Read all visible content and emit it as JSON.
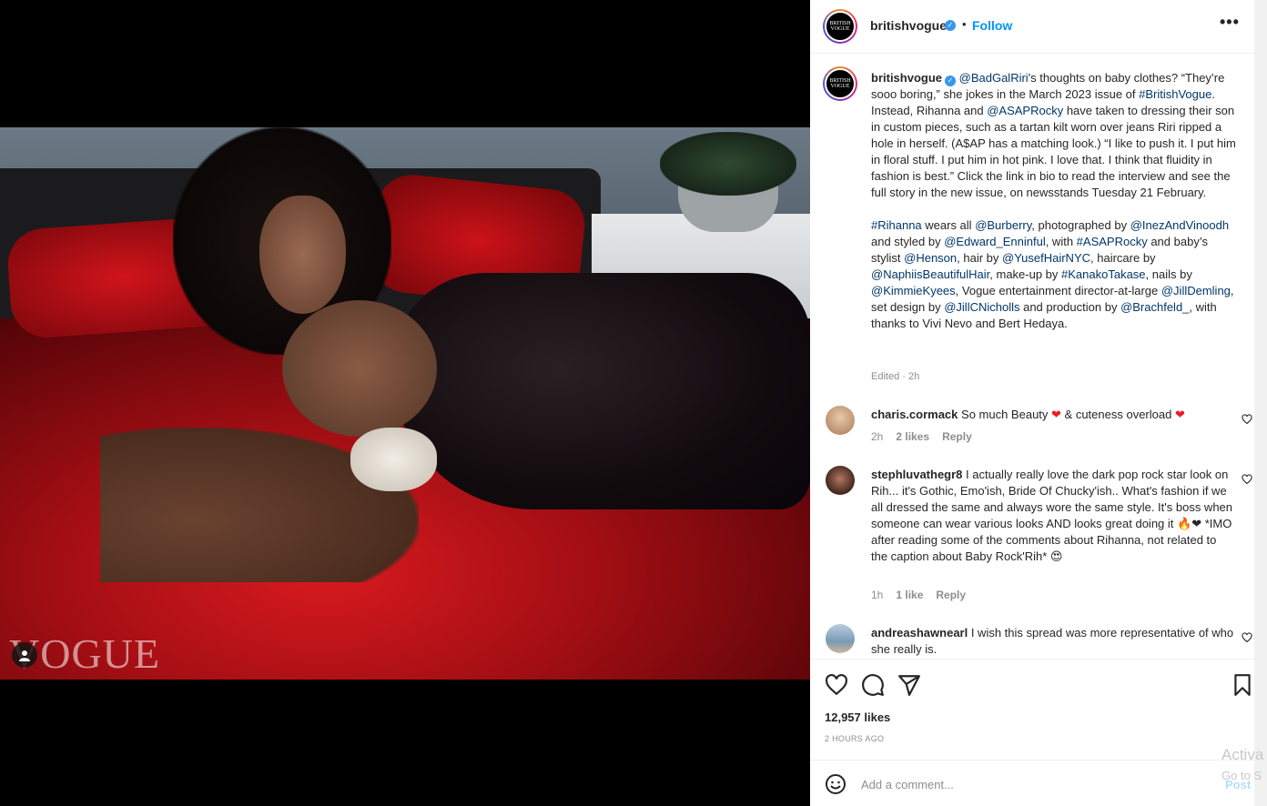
{
  "post": {
    "account": "britishvogue",
    "avatar_text": "BRITISH VOGUE",
    "follow_label": "Follow",
    "more_label": "•••",
    "watermark": "VOGUE"
  },
  "caption": {
    "username": "britishvogue",
    "parts": [
      {
        "t": "@BadGalRiri",
        "link": true
      },
      {
        "t": "'s thoughts on baby clothes? “They’re sooo boring,” she jokes in the March 2023 issue of ",
        "link": false
      },
      {
        "t": "#BritishVogue",
        "link": true
      },
      {
        "t": ". Instead, Rihanna and ",
        "link": false
      },
      {
        "t": "@ASAPRocky",
        "link": true
      },
      {
        "t": " have taken to dressing their son in custom pieces, such as a tartan kilt worn over jeans Riri ripped a hole in herself. (A$AP has a matching look.) “I like to push it. I put him in floral stuff. I put him in hot pink. I love that. I think that fluidity in fashion is best.” Click the link in bio to read the interview and see the full story in the new issue, on newsstands Tuesday 21 February.",
        "link": false
      }
    ],
    "credits": [
      {
        "t": "#Rihanna",
        "link": true
      },
      {
        "t": " wears all ",
        "link": false
      },
      {
        "t": "@Burberry",
        "link": true
      },
      {
        "t": ", photographed by ",
        "link": false
      },
      {
        "t": "@InezAndVinoodh",
        "link": true
      },
      {
        "t": " and styled by ",
        "link": false
      },
      {
        "t": "@Edward_Enninful",
        "link": true
      },
      {
        "t": ", with ",
        "link": false
      },
      {
        "t": "#ASAPRocky",
        "link": true
      },
      {
        "t": " and baby’s stylist ",
        "link": false
      },
      {
        "t": "@Henson",
        "link": true
      },
      {
        "t": ", hair by ",
        "link": false
      },
      {
        "t": "@YusefHairNYC",
        "link": true
      },
      {
        "t": ", haircare by ",
        "link": false
      },
      {
        "t": "@NaphiisBeautifulHair",
        "link": true
      },
      {
        "t": ", make-up by ",
        "link": false
      },
      {
        "t": "#KanakoTakase",
        "link": true
      },
      {
        "t": ", nails by ",
        "link": false
      },
      {
        "t": "@KimmieKyees",
        "link": true
      },
      {
        "t": ", Vogue entertainment director-at-large ",
        "link": false
      },
      {
        "t": "@JillDemling",
        "link": true
      },
      {
        "t": ", set design by ",
        "link": false
      },
      {
        "t": "@JillCNicholls",
        "link": true
      },
      {
        "t": " and production by ",
        "link": false
      },
      {
        "t": "@Brachfeld_",
        "link": true
      },
      {
        "t": ", with thanks to Vivi Nevo and Bert Hedaya.",
        "link": false
      }
    ],
    "edited": "Edited · 2h"
  },
  "comments": [
    {
      "username": "charis.cormack",
      "text_before": " So much Beauty ",
      "heart1": "❤",
      "text_mid": " & cuteness overload ",
      "heart2": "❤",
      "time": "2h",
      "likes": "2 likes",
      "reply": "Reply"
    },
    {
      "username": "stephluvathegr8",
      "text": " I actually really love the dark pop rock star look on Rih... it's Gothic, Emo'ish, Bride Of Chucky'ish.. What's fashion if we all dressed the same and always wore the same style. It's boss when someone can wear various looks AND looks great doing it 🔥❤ *IMO after reading some of the comments about Rihanna, not related to the caption about Baby Rock'Rih* 😍",
      "time": "1h",
      "likes": "1 like",
      "reply": "Reply"
    },
    {
      "username": "andreashawnearl",
      "text": " I wish this spread was more representative of who she really is."
    }
  ],
  "footer": {
    "likes": "12,957 likes",
    "time": "2 HOURS AGO",
    "comment_placeholder": "Add a comment...",
    "post_label": "Post"
  },
  "watermark": {
    "line1": "Activa",
    "line2": "Go to S"
  },
  "colors": {
    "link": "#00376b",
    "follow": "#0095f6",
    "verified": "#3897f0"
  }
}
